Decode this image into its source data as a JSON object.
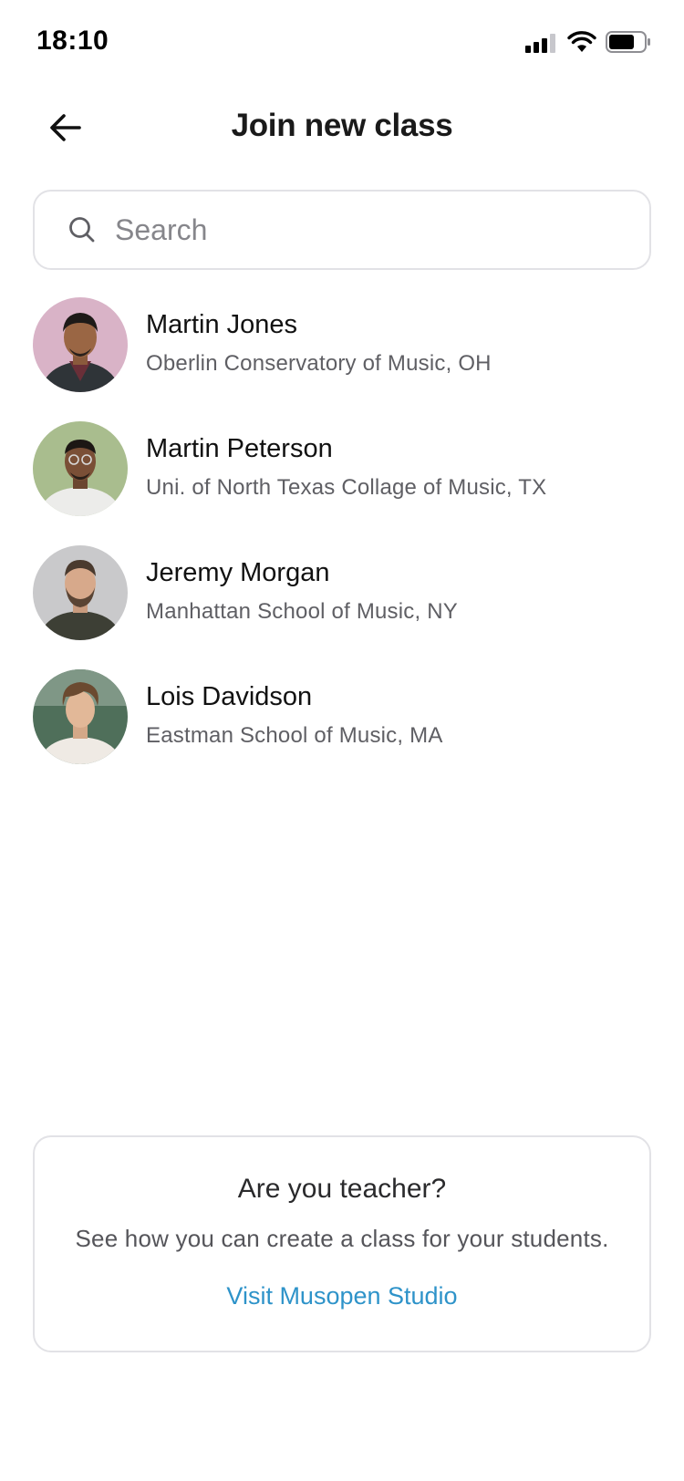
{
  "status_bar": {
    "time": "18:10",
    "icons": [
      "signal-icon",
      "wifi-icon",
      "battery-icon"
    ]
  },
  "header": {
    "back_icon": "arrow-left-icon",
    "title": "Join new class"
  },
  "search": {
    "icon": "search-icon",
    "placeholder": "Search",
    "value": ""
  },
  "teachers": [
    {
      "name": "Martin Jones",
      "school": "Oberlin Conservatory of Music, OH",
      "avatar_bg": "#d9b3c7"
    },
    {
      "name": "Martin Peterson",
      "school": "Uni. of North Texas Collage of Music, TX",
      "avatar_bg": "#a9bd8e"
    },
    {
      "name": "Jeremy Morgan",
      "school": "Manhattan School of Music, NY",
      "avatar_bg": "#c9c9cb"
    },
    {
      "name": "Lois Davidson",
      "school": "Eastman School of Music, MA",
      "avatar_bg": "#4f6f5a"
    }
  ],
  "teacher_card": {
    "title": "Are you teacher?",
    "text": "See how you can create a class for your students.",
    "link_label": "Visit Musopen Studio"
  },
  "colors": {
    "accent_link": "#2e93c9",
    "border": "#e2e2e6",
    "secondary_text": "#5f5f64"
  }
}
